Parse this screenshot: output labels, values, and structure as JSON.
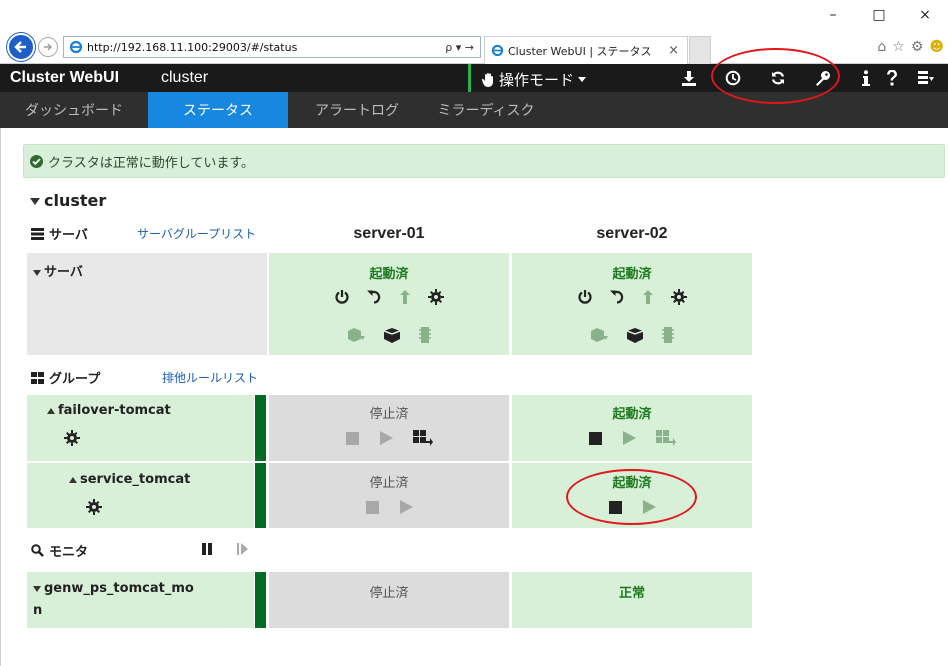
{
  "browser": {
    "url": "http://192.168.11.100:29003/#/status",
    "address_controls": "ρ ▾ →",
    "tab_title": "Cluster WebUI | ステータス",
    "tab_close": "×",
    "window_controls": [
      "–",
      "□",
      "×"
    ]
  },
  "header": {
    "brand": "Cluster WebUI",
    "cluster_name": "cluster",
    "mode_label": "操作モード",
    "accent_color": "#2db04b"
  },
  "tabs": [
    {
      "label": "ダッシュボード",
      "active": false
    },
    {
      "label": "ステータス",
      "active": true
    },
    {
      "label": "アラートログ",
      "active": false
    },
    {
      "label": "ミラーディスク",
      "active": false
    }
  ],
  "alert": {
    "text": "クラスタは正常に動作しています。"
  },
  "cluster": {
    "name": "cluster"
  },
  "servers_section": {
    "title": "サーバ",
    "link": "サーバグループリスト"
  },
  "columns": [
    "server-01",
    "server-02"
  ],
  "server_row": {
    "label": "サーバ",
    "status": [
      "起動済",
      "起動済"
    ]
  },
  "groups_section": {
    "title": "グループ",
    "link": "排他ルールリスト"
  },
  "groups": [
    {
      "name": "failover-tomcat",
      "status": [
        "停止済",
        "起動済"
      ]
    },
    {
      "name": "service_tomcat",
      "status": [
        "停止済",
        "起動済"
      ]
    }
  ],
  "monitors_section": {
    "title": "モニタ"
  },
  "monitors": [
    {
      "name_line1": "genw_ps_tomcat_mo",
      "name_line2": "n",
      "status": [
        "停止済",
        "正常"
      ]
    }
  ],
  "colors": {
    "status_green": "#1d7a1d",
    "cell_green": "#d8efd8",
    "cell_grey": "#dcdcdc",
    "highlight_red": "#e0171b",
    "active_tab": "#1787e0"
  }
}
